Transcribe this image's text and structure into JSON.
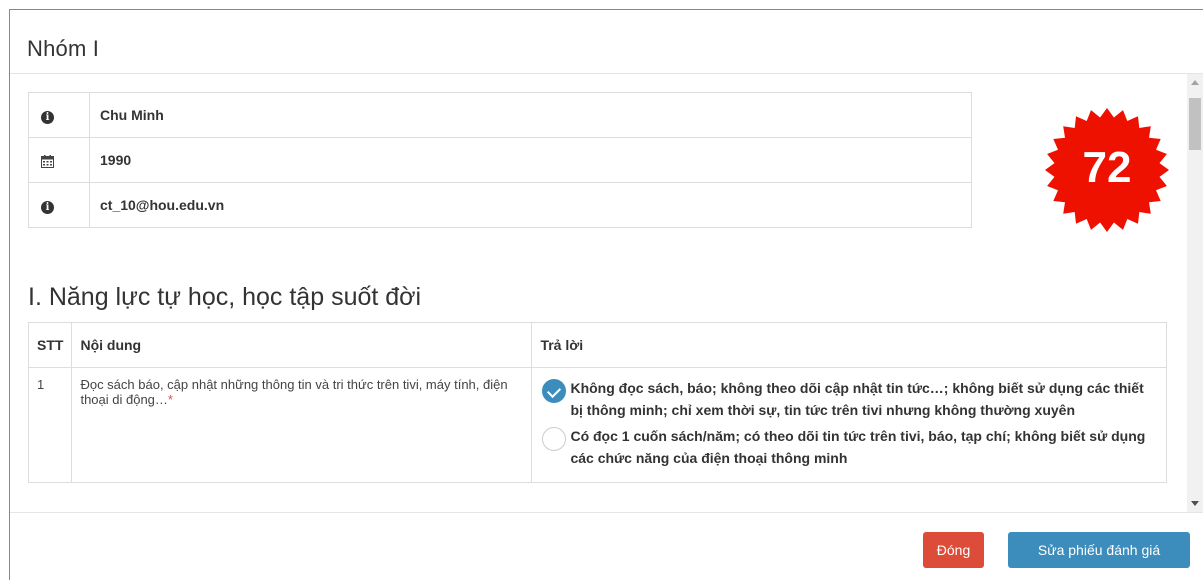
{
  "modal": {
    "title": "Nhóm I"
  },
  "profile": [
    {
      "icon": "info-icon",
      "value": "Chu Minh"
    },
    {
      "icon": "calendar-icon",
      "value": "1990"
    },
    {
      "icon": "info-icon",
      "value": "ct_10@hou.edu.vn"
    }
  ],
  "score": {
    "value": "72",
    "badge_color": "#ee1100"
  },
  "section": {
    "title": "I. Năng lực tự học, học tập suốt đời"
  },
  "question_table": {
    "headers": {
      "stt": "STT",
      "content": "Nội dung",
      "answer": "Trả lời"
    },
    "rows": [
      {
        "stt": "1",
        "content": "Đọc sách báo, cập nhật những thông tin và tri thức trên tivi, máy tính, điện thoại di động…",
        "required_mark": "*",
        "options": [
          {
            "text": "Không đọc sách, báo; không theo dõi cập nhật tin tức…; không biết sử dụng các thiết bị thông minh; chỉ xem thời sự, tin tức trên tivi nhưng không thường xuyên",
            "selected": true
          },
          {
            "text": "Có đọc 1 cuốn sách/năm; có theo dõi tin tức trên tivi, báo, tạp chí; không biết sử dụng các chức năng của điện thoại thông minh",
            "selected": false
          }
        ]
      }
    ]
  },
  "footer": {
    "close_label": "Đóng",
    "edit_label": "Sửa phiếu đánh giá"
  },
  "colors": {
    "accent": "#3c8dbc",
    "danger": "#dd4b39"
  }
}
